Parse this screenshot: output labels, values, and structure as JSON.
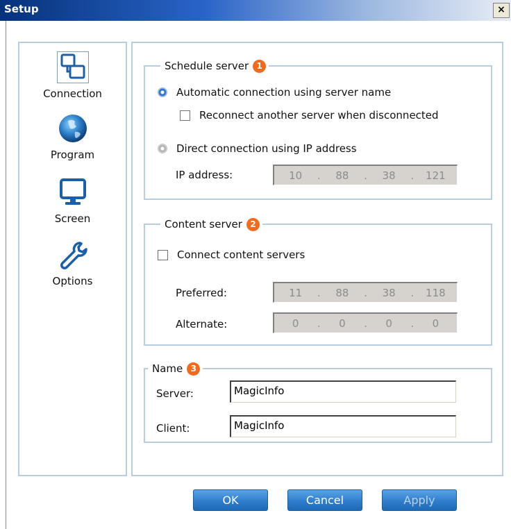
{
  "window": {
    "title": "Setup",
    "close_glyph": "×"
  },
  "sidebar": {
    "items": [
      {
        "label": "Connection",
        "icon": "connection-icon",
        "selected": true
      },
      {
        "label": "Program",
        "icon": "globe-icon",
        "selected": false
      },
      {
        "label": "Screen",
        "icon": "monitor-icon",
        "selected": false
      },
      {
        "label": "Options",
        "icon": "wrench-icon",
        "selected": false
      }
    ]
  },
  "schedule_server": {
    "legend": "Schedule server",
    "badge": "1",
    "auto_connect_label": "Automatic connection using server name",
    "auto_connect_selected": true,
    "reconnect_label": "Reconnect another server when disconnected",
    "reconnect_checked": false,
    "direct_connect_label": "Direct connection using IP address",
    "direct_connect_selected": false,
    "ip_label": "IP address:",
    "ip": [
      "10",
      "88",
      "38",
      "121"
    ]
  },
  "content_server": {
    "legend": "Content server",
    "badge": "2",
    "connect_label": "Connect content servers",
    "connect_checked": false,
    "preferred_label": "Preferred:",
    "preferred_ip": [
      "11",
      "88",
      "38",
      "118"
    ],
    "alternate_label": "Alternate:",
    "alternate_ip": [
      "0",
      "0",
      "0",
      "0"
    ]
  },
  "name_group": {
    "legend": "Name",
    "badge": "3",
    "server_label": "Server:",
    "server_value": "MagicInfo",
    "client_label": "Client:",
    "client_value": "MagicInfo"
  },
  "buttons": {
    "ok": "OK",
    "cancel": "Cancel",
    "apply": "Apply"
  },
  "colors": {
    "accent": "#2f7dcc",
    "badge": "#f26b1d",
    "group_border": "#b8cde3"
  }
}
